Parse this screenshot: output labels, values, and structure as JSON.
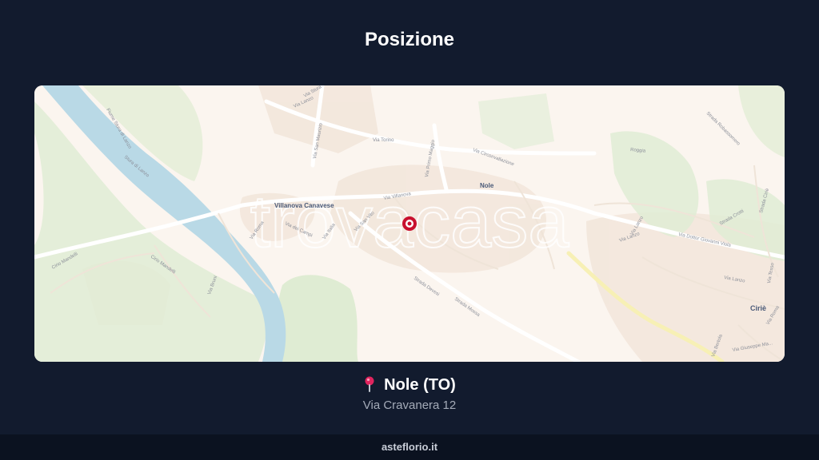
{
  "page": {
    "title": "Posizione"
  },
  "map": {
    "watermark": "trovacasa",
    "marker_icon": "map-marker-icon",
    "places": {
      "villanova": "Villanova Canavese",
      "nole": "Nole",
      "cirie": "Ciriè"
    },
    "streets": {
      "via_lanzo_top": "Via Lanzo",
      "via_torino": "Via Torino",
      "via_circonvallazione": "Via Circonvallazione",
      "via_san_maurizio": "Via San Maurizio",
      "via_primo_maggio": "Via Primo Maggio",
      "via_villanova": "Via Villanova",
      "via_dei_campi": "Via dei Campi",
      "via_roma": "Via Roma",
      "via_italia": "Via Italia",
      "via_san_vito": "Via San Vito",
      "strada_devesi": "Strada Devesi",
      "strada_mossa": "Strada Mossa",
      "via_lanzo_right": "Via Lanzo",
      "via_lanzo_right2": "Via Lanzo",
      "via_lanzo_vert": "Via Lanzo",
      "via_dottor_giovanni_viola": "Via Dottor Giovanni Viola",
      "strada_crotti": "Strada Crotti",
      "strada_cirie": "Strada Ciriè",
      "strada_robassomero": "Strada Robassomero",
      "via_bertola": "Via Bertola",
      "via_giuseppe": "Via Giuseppe Ma...",
      "via_roma_right": "Via Roma",
      "via_tesso": "Via Tesso",
      "via_stura": "Via Stura",
      "fiume_stura": "Fiume Stura di Lanzo",
      "stura_lanzo": "Stura di Lanzo",
      "ciriu_mandelli": "Cirio Mandelli",
      "ciriu_mandelli2": "Cirio Mandelli",
      "via_bruni": "Via Bruni",
      "roggia": "Roggia"
    }
  },
  "location": {
    "city": "Nole (TO)",
    "address": "Via Cravanera 12",
    "pin_icon": "pushpin-icon"
  },
  "footer": {
    "brand": "asteflorio.it"
  },
  "colors": {
    "background": "#121b2e",
    "map_land": "#fbf5ef",
    "map_park": "#dfecd3",
    "map_water": "#b9d9e6",
    "marker": "#c8102e"
  }
}
